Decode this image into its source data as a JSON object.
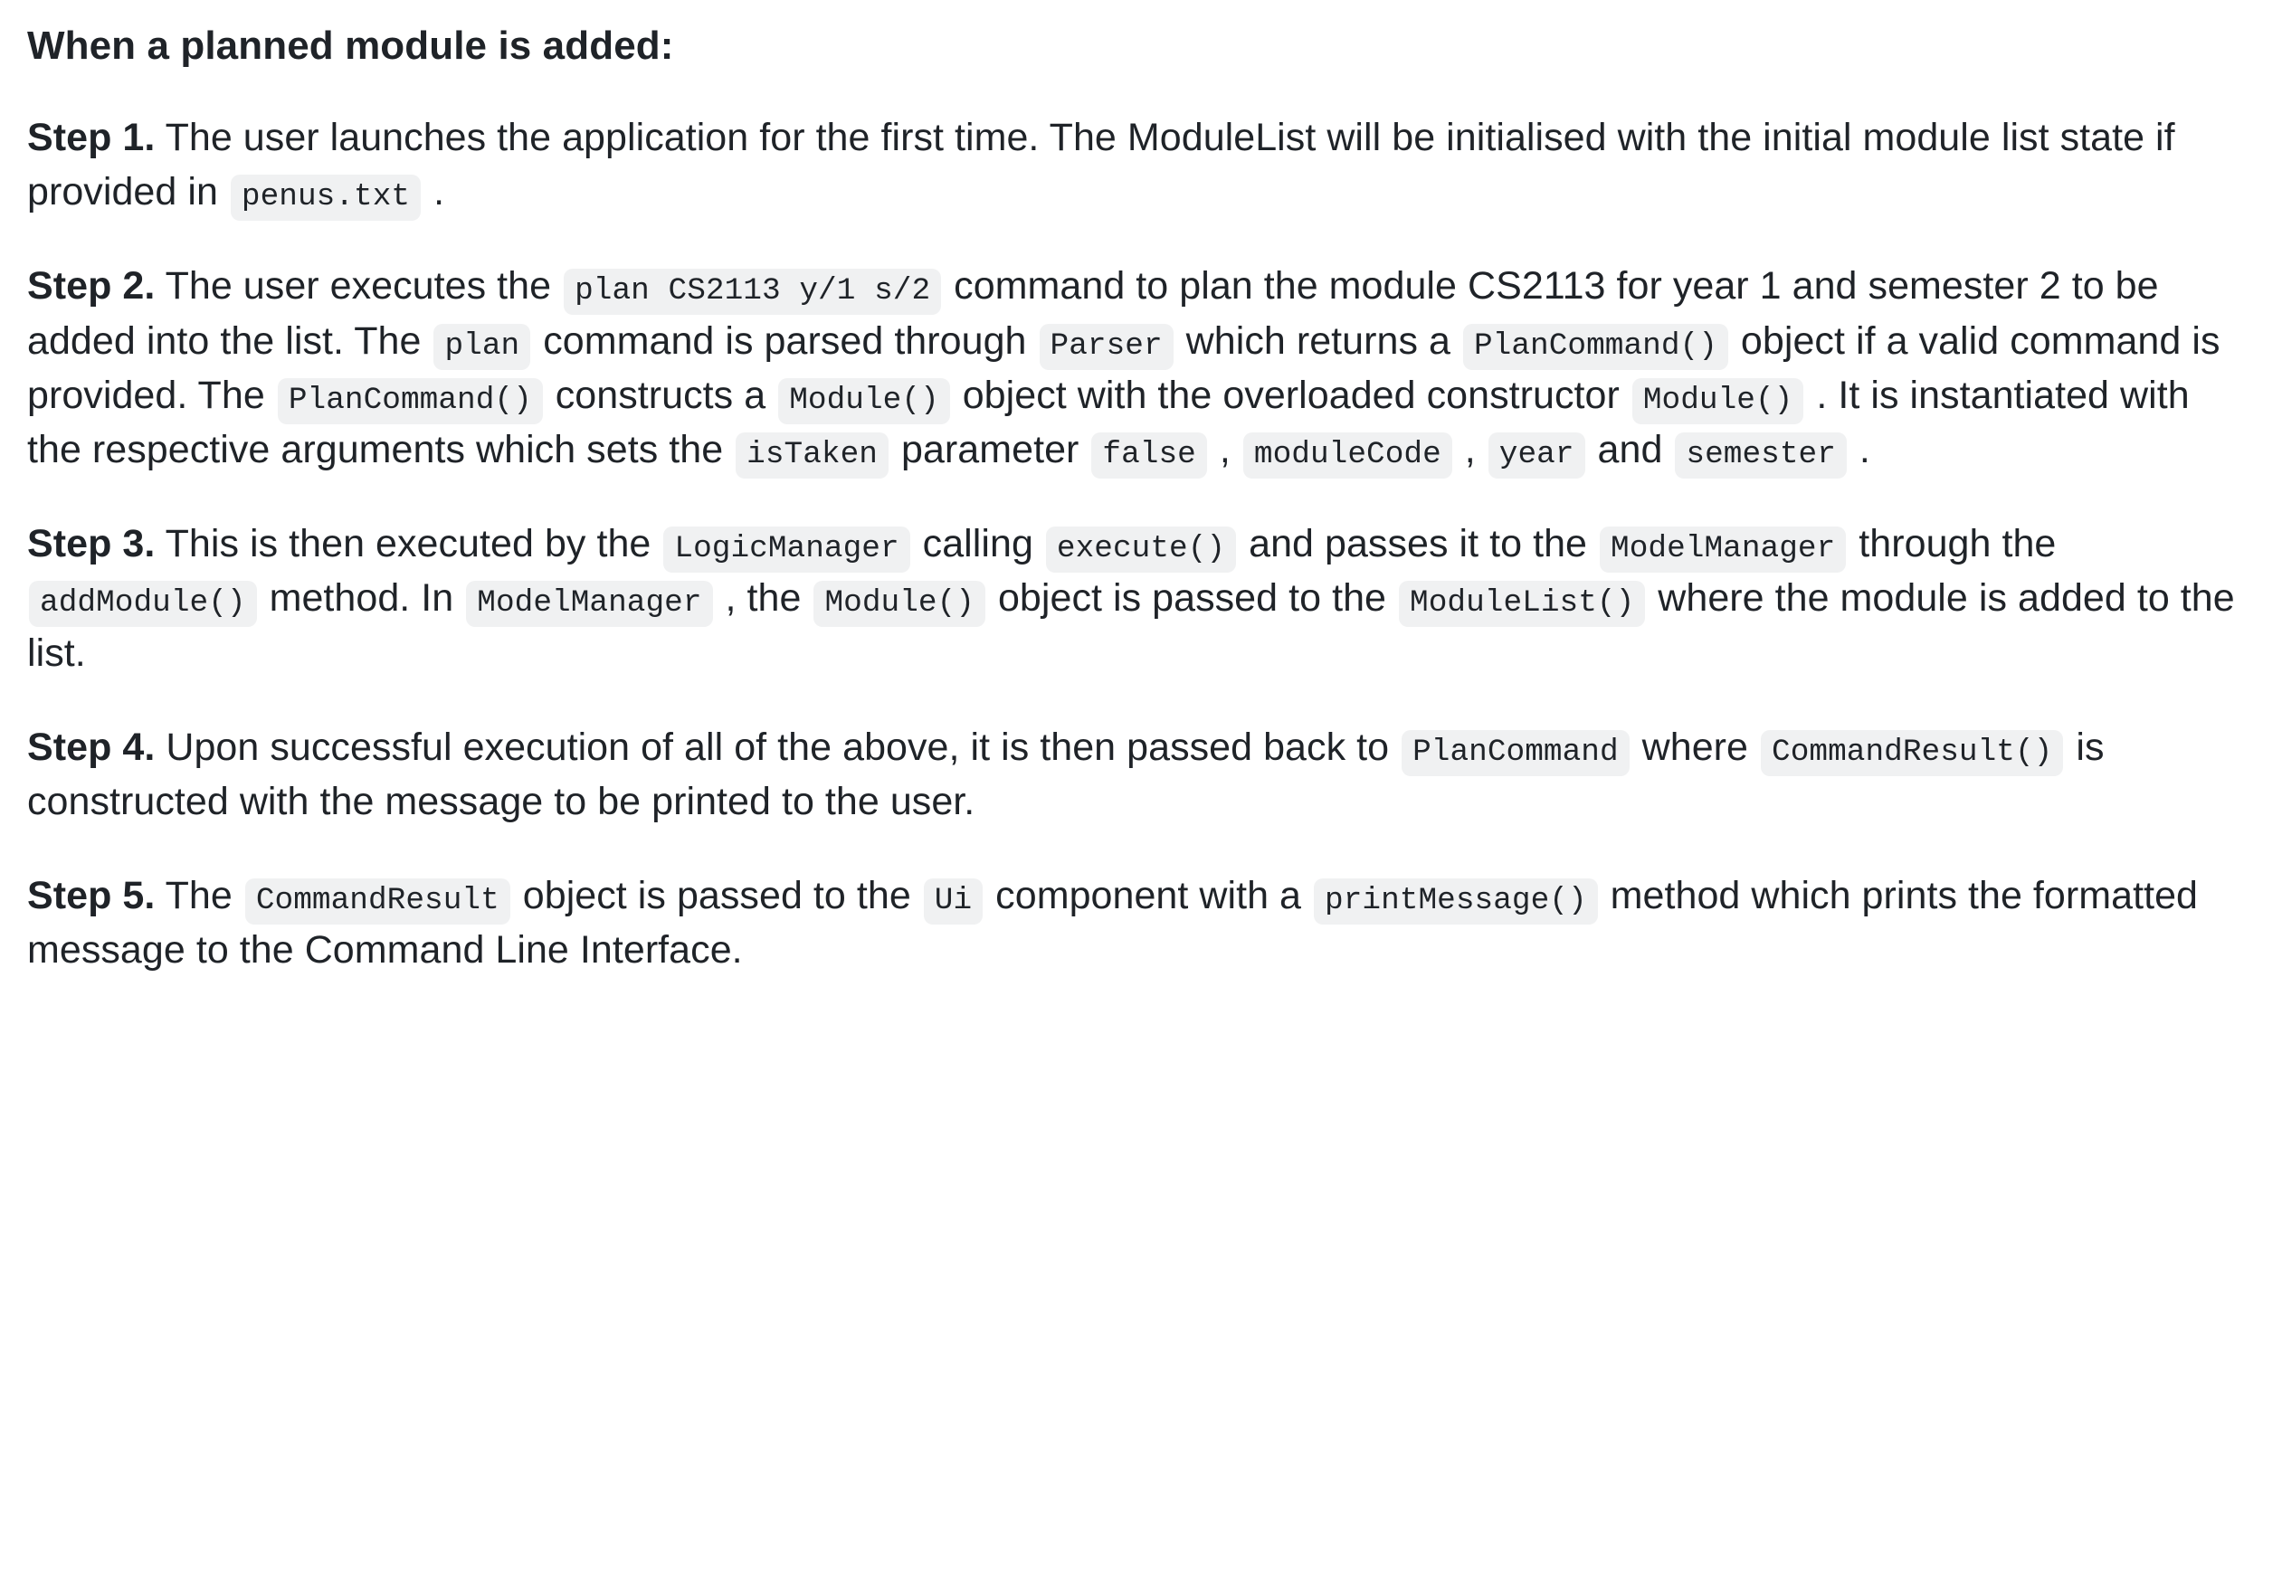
{
  "document": {
    "heading": "When a planned module is added:",
    "steps": [
      {
        "label": "Step 1.",
        "parts": [
          {
            "type": "text",
            "value": " The user launches the application for the first time. The ModuleList will be initialised with the initial module list state if provided in "
          },
          {
            "type": "code",
            "value": "penus.txt"
          },
          {
            "type": "text",
            "value": " ."
          }
        ]
      },
      {
        "label": "Step 2.",
        "parts": [
          {
            "type": "text",
            "value": " The user executes the "
          },
          {
            "type": "code",
            "value": "plan CS2113 y/1 s/2"
          },
          {
            "type": "text",
            "value": " command to plan the module CS2113 for year 1 and semester 2 to be added into the list. The "
          },
          {
            "type": "code",
            "value": "plan"
          },
          {
            "type": "text",
            "value": " command is parsed through "
          },
          {
            "type": "code",
            "value": "Parser"
          },
          {
            "type": "text",
            "value": " which returns a "
          },
          {
            "type": "code",
            "value": "PlanCommand()"
          },
          {
            "type": "text",
            "value": " object if a valid command is provided. The "
          },
          {
            "type": "code",
            "value": "PlanCommand()"
          },
          {
            "type": "text",
            "value": " constructs a "
          },
          {
            "type": "code",
            "value": "Module()"
          },
          {
            "type": "text",
            "value": " object with the overloaded constructor "
          },
          {
            "type": "code",
            "value": "Module()"
          },
          {
            "type": "text",
            "value": " . It is instantiated with the respective arguments which sets the "
          },
          {
            "type": "code",
            "value": "isTaken"
          },
          {
            "type": "text",
            "value": " parameter "
          },
          {
            "type": "code",
            "value": "false"
          },
          {
            "type": "text",
            "value": " , "
          },
          {
            "type": "code",
            "value": "moduleCode"
          },
          {
            "type": "text",
            "value": " , "
          },
          {
            "type": "code",
            "value": "year"
          },
          {
            "type": "text",
            "value": " and "
          },
          {
            "type": "code",
            "value": "semester"
          },
          {
            "type": "text",
            "value": " ."
          }
        ]
      },
      {
        "label": "Step 3.",
        "parts": [
          {
            "type": "text",
            "value": " This is then executed by the "
          },
          {
            "type": "code",
            "value": "LogicManager"
          },
          {
            "type": "text",
            "value": " calling "
          },
          {
            "type": "code",
            "value": "execute()"
          },
          {
            "type": "text",
            "value": " and passes it to the "
          },
          {
            "type": "code",
            "value": "ModelManager"
          },
          {
            "type": "text",
            "value": " through the "
          },
          {
            "type": "code",
            "value": "addModule()"
          },
          {
            "type": "text",
            "value": " method. In "
          },
          {
            "type": "code",
            "value": "ModelManager"
          },
          {
            "type": "text",
            "value": " , the "
          },
          {
            "type": "code",
            "value": "Module()"
          },
          {
            "type": "text",
            "value": " object is passed to the "
          },
          {
            "type": "code",
            "value": "ModuleList()"
          },
          {
            "type": "text",
            "value": " where the module is added to the list."
          }
        ]
      },
      {
        "label": "Step 4.",
        "parts": [
          {
            "type": "text",
            "value": " Upon successful execution of all of the above, it is then passed back to "
          },
          {
            "type": "code",
            "value": "PlanCommand"
          },
          {
            "type": "text",
            "value": " where "
          },
          {
            "type": "code",
            "value": "CommandResult()"
          },
          {
            "type": "text",
            "value": " is constructed with the message to be printed to the user."
          }
        ]
      },
      {
        "label": "Step 5.",
        "parts": [
          {
            "type": "text",
            "value": " The "
          },
          {
            "type": "code",
            "value": "CommandResult"
          },
          {
            "type": "text",
            "value": " object is passed to the "
          },
          {
            "type": "code",
            "value": "Ui"
          },
          {
            "type": "text",
            "value": " component with a "
          },
          {
            "type": "code",
            "value": "printMessage()"
          },
          {
            "type": "text",
            "value": " method which prints the formatted message to the Command Line Interface."
          }
        ]
      }
    ],
    "colors": {
      "text": "#1f2328",
      "code_background": "#f0f1f2",
      "page_background": "#ffffff"
    }
  }
}
